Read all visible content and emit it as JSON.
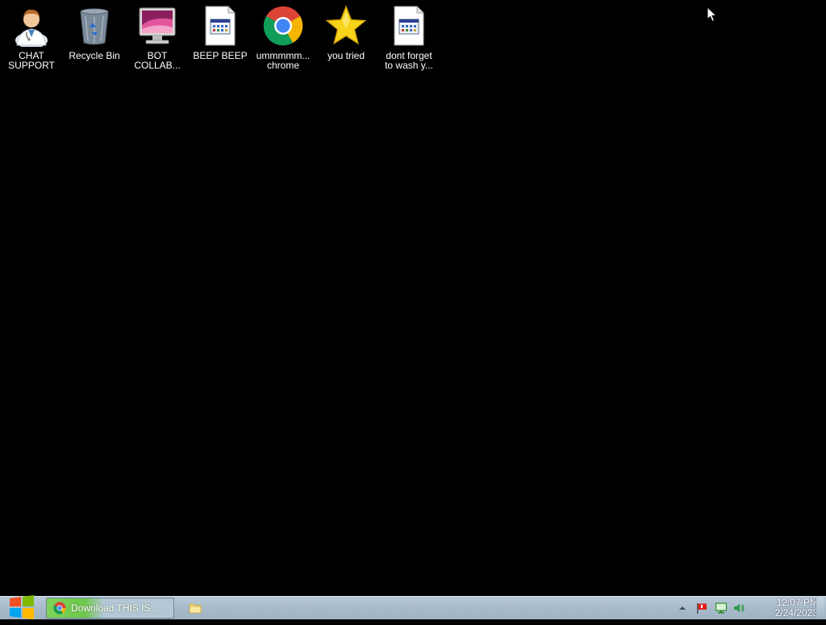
{
  "desktop": {
    "icons": [
      {
        "label": "CHAT\nSUPPORT",
        "icon": "doctor-user-icon"
      },
      {
        "label": "Recycle Bin",
        "icon": "recycle-bin-icon"
      },
      {
        "label": "BOT\nCOLLAB...",
        "icon": "monitor-icon"
      },
      {
        "label": "BEEP BEEP",
        "icon": "document-icon"
      },
      {
        "label": "ummmmm...\nchrome",
        "icon": "chrome-icon"
      },
      {
        "label": "you tried",
        "icon": "star-icon"
      },
      {
        "label": "dont forget\nto wash y...",
        "icon": "document-icon"
      }
    ]
  },
  "taskbar": {
    "start_icon": "windows-logo-icon",
    "active_task_label": "Download THIS IS ...",
    "active_task_icon": "chrome-icon",
    "folder_task_icon": "folder-icon"
  },
  "tray": {
    "icons": [
      "show-hidden-arrow-icon",
      "action-center-flag-icon",
      "network-icon",
      "volume-icon"
    ],
    "time": "12:07 PM",
    "date": "2/24/2023"
  },
  "colors": {
    "desktop_bg": "#000000",
    "taskbar_bg": "#a9bccc",
    "task_progress": "#6cc84a"
  }
}
